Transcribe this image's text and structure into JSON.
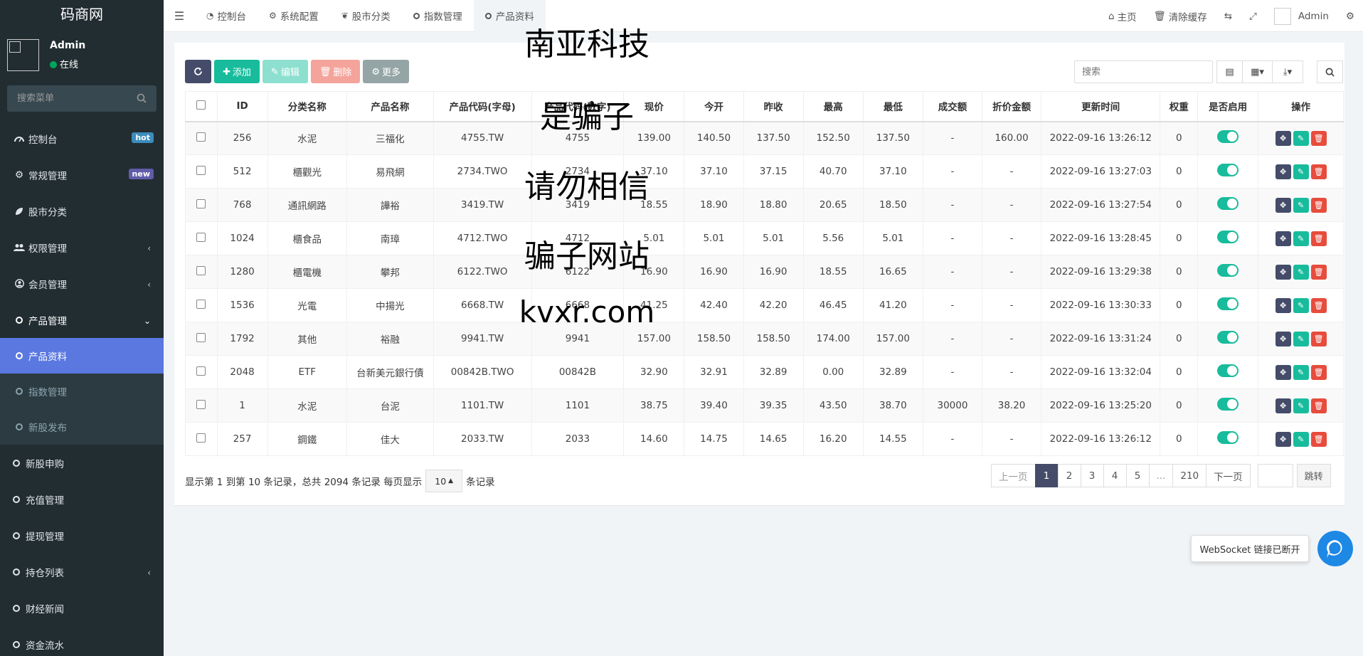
{
  "sidebar": {
    "logo": "码商网",
    "user": {
      "name": "Admin",
      "status": "在线"
    },
    "search_placeholder": "搜索菜单",
    "items": [
      {
        "label": "控制台",
        "icon": "dashboard-icon",
        "badge": "hot",
        "badge_color": "#3c8dbc"
      },
      {
        "label": "常规管理",
        "icon": "cogs-icon",
        "badge": "new",
        "badge_color": "#605ca8"
      },
      {
        "label": "股市分类",
        "icon": "leaf-icon"
      },
      {
        "label": "权限管理",
        "icon": "group-icon"
      },
      {
        "label": "会员管理",
        "icon": "user-circle-icon"
      },
      {
        "label": "产品管理",
        "icon": "circle-icon"
      }
    ],
    "sub_items": [
      {
        "label": "产品资料",
        "active": true
      },
      {
        "label": "指数管理"
      },
      {
        "label": "新股发布"
      }
    ],
    "items_after": [
      {
        "label": "新股申购"
      },
      {
        "label": "充值管理"
      },
      {
        "label": "提现管理"
      },
      {
        "label": "持仓列表"
      },
      {
        "label": "财经新闻"
      },
      {
        "label": "资金流水"
      }
    ]
  },
  "header": {
    "tabs": [
      "控制台",
      "系统配置",
      "股市分类",
      "指数管理",
      "产品资料"
    ],
    "active_tab": "产品资料",
    "home": "主页",
    "clear_cache": "清除缓存",
    "admin": "Admin"
  },
  "toolbar": {
    "add": "添加",
    "edit": "编辑",
    "delete": "删除",
    "more": "更多",
    "search_placeholder": "搜索"
  },
  "table": {
    "headers": [
      "ID",
      "分类名称",
      "产品名称",
      "产品代码(字母)",
      "产品代码(数字)",
      "现价",
      "今开",
      "昨收",
      "最高",
      "最低",
      "成交额",
      "折价金额",
      "更新时间",
      "权重",
      "是否启用",
      "操作"
    ],
    "rows": [
      [
        "256",
        "水泥",
        "三福化",
        "4755.TW",
        "4755",
        "139.00",
        "140.50",
        "137.50",
        "152.50",
        "137.50",
        "-",
        "160.00",
        "2022-09-16 13:26:12",
        "0"
      ],
      [
        "512",
        "櫃觀光",
        "易飛網",
        "2734.TWO",
        "2734",
        "37.10",
        "37.10",
        "37.15",
        "40.70",
        "37.10",
        "-",
        "-",
        "2022-09-16 13:27:03",
        "0"
      ],
      [
        "768",
        "通訊網路",
        "譁裕",
        "3419.TW",
        "3419",
        "18.55",
        "18.90",
        "18.80",
        "20.65",
        "18.50",
        "-",
        "-",
        "2022-09-16 13:27:54",
        "0"
      ],
      [
        "1024",
        "櫃食品",
        "南璋",
        "4712.TWO",
        "4712",
        "5.01",
        "5.01",
        "5.01",
        "5.56",
        "5.01",
        "-",
        "-",
        "2022-09-16 13:28:45",
        "0"
      ],
      [
        "1280",
        "櫃電機",
        "攀邦",
        "6122.TWO",
        "6122",
        "16.90",
        "16.90",
        "16.90",
        "18.55",
        "16.65",
        "-",
        "-",
        "2022-09-16 13:29:38",
        "0"
      ],
      [
        "1536",
        "光電",
        "中揚光",
        "6668.TW",
        "6668",
        "41.25",
        "42.40",
        "42.20",
        "46.45",
        "41.20",
        "-",
        "-",
        "2022-09-16 13:30:33",
        "0"
      ],
      [
        "1792",
        "其他",
        "裕融",
        "9941.TW",
        "9941",
        "157.00",
        "158.50",
        "158.50",
        "174.00",
        "157.00",
        "-",
        "-",
        "2022-09-16 13:31:24",
        "0"
      ],
      [
        "2048",
        "ETF",
        "台新美元銀行債",
        "00842B.TWO",
        "00842B",
        "32.90",
        "32.91",
        "32.89",
        "0.00",
        "32.89",
        "-",
        "-",
        "2022-09-16 13:32:04",
        "0"
      ],
      [
        "1",
        "水泥",
        "台泥",
        "1101.TW",
        "1101",
        "38.75",
        "39.40",
        "39.35",
        "43.50",
        "38.70",
        "30000",
        "38.20",
        "2022-09-16 13:25:20",
        "0"
      ],
      [
        "257",
        "鋼鐵",
        "佳大",
        "2033.TW",
        "2033",
        "14.60",
        "14.75",
        "14.65",
        "16.20",
        "14.55",
        "-",
        "-",
        "2022-09-16 13:26:12",
        "0"
      ]
    ]
  },
  "pagination": {
    "info_prefix": "显示第 1 到第 10 条记录，总共 2094 条记录 每页显示",
    "page_size": "10",
    "info_suffix": "条记录",
    "prev": "上一页",
    "pages": [
      "1",
      "2",
      "3",
      "4",
      "5",
      "...",
      "210"
    ],
    "next": "下一页",
    "go": "跳转"
  },
  "watermark": [
    "南亚科技",
    "是骗子",
    "请勿相信",
    "骗子网站",
    "kvxr.com"
  ],
  "websocket": "WebSocket 链接已断开",
  "colors": {
    "accent": "#444c69",
    "green": "#18bc9c",
    "red": "#e74c3c",
    "sidebar": "#222d32",
    "active_menu": "#5a78e0"
  }
}
